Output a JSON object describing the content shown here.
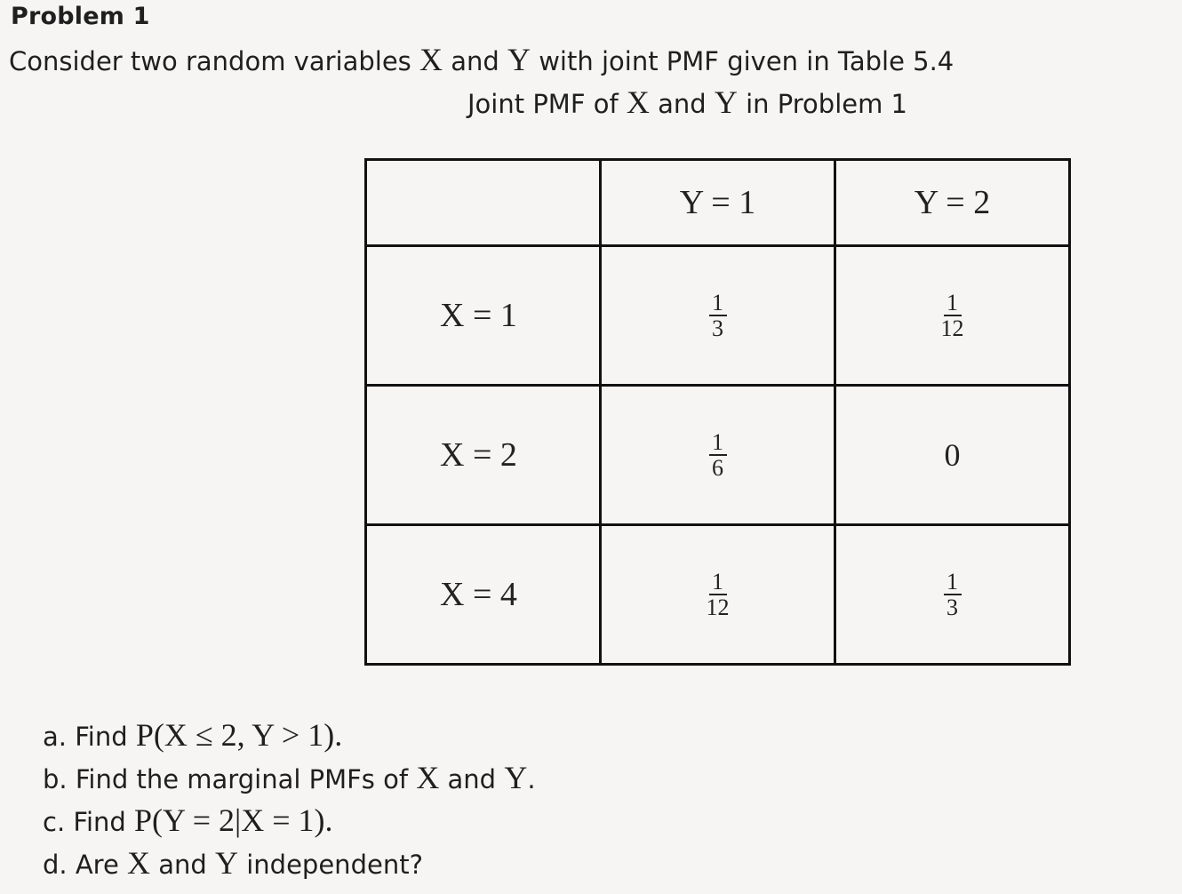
{
  "problem": {
    "title": "Problem 1",
    "intro": {
      "before_x": "Consider two random variables ",
      "x": "X",
      "and": " and ",
      "y": "Y",
      "after_y": " with joint PMF given in Table 5.4"
    }
  },
  "caption": {
    "prefix": "Joint PMF of ",
    "x": "X",
    "and": " and ",
    "y": "Y",
    "suffix": " in Problem 1"
  },
  "table": {
    "column_headers": [
      "",
      "Y = 1",
      "Y = 2"
    ],
    "rows": [
      {
        "label": "X = 1",
        "cells": [
          {
            "type": "fraction",
            "num": "1",
            "den": "3"
          },
          {
            "type": "fraction",
            "num": "1",
            "den": "12"
          }
        ]
      },
      {
        "label": "X = 2",
        "cells": [
          {
            "type": "fraction",
            "num": "1",
            "den": "6"
          },
          {
            "type": "number",
            "value": "0"
          }
        ]
      },
      {
        "label": "X = 4",
        "cells": [
          {
            "type": "fraction",
            "num": "1",
            "den": "12"
          },
          {
            "type": "fraction",
            "num": "1",
            "den": "3"
          }
        ]
      }
    ]
  },
  "questions": {
    "a": {
      "prefix": "a. Find ",
      "expr": "P(X ≤ 2, Y > 1)",
      "suffix": "."
    },
    "b": {
      "prefix": "b. Find the marginal PMFs of ",
      "x": "X",
      "and": " and ",
      "y": "Y",
      "suffix": "."
    },
    "c": {
      "prefix": "c. Find ",
      "expr": "P(Y = 2|X = 1)",
      "suffix": "."
    },
    "d": {
      "prefix": "d. Are ",
      "x": "X",
      "and": " and ",
      "y": "Y",
      "suffix": " independent?"
    }
  }
}
